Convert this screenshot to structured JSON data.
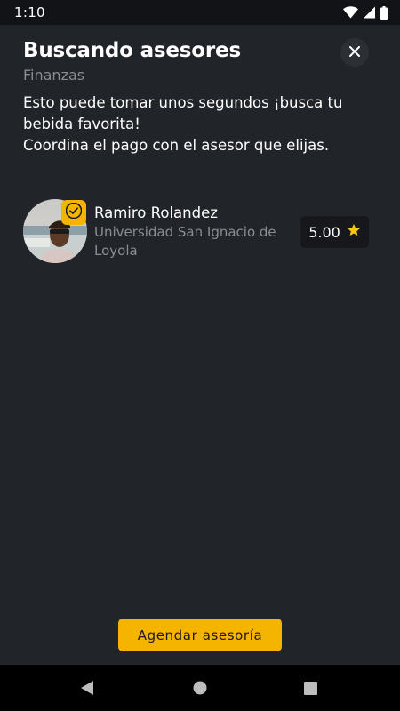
{
  "status_bar": {
    "time": "1:10",
    "icons": [
      "wifi-icon",
      "signal-icon",
      "battery-icon"
    ]
  },
  "header": {
    "title": "Buscando asesores",
    "subtitle": "Finanzas",
    "close_icon": "close-icon"
  },
  "description": {
    "line1": "Esto puede tomar unos segundos ¡busca tu bebida favorita!",
    "line2": "Coordina el pago con el asesor que elijas."
  },
  "advisors": [
    {
      "name": "Ramiro Rolandez",
      "school": "Universidad San Ignacio de Loyola",
      "rating": "5.00",
      "verified": true
    }
  ],
  "cta": {
    "label": "Agendar asesoría"
  },
  "nav": {
    "icons": [
      "back-icon",
      "home-icon",
      "recents-icon"
    ]
  },
  "colors": {
    "background": "#212428",
    "accent": "#f5b400",
    "secondary_text": "#8a8e94"
  }
}
